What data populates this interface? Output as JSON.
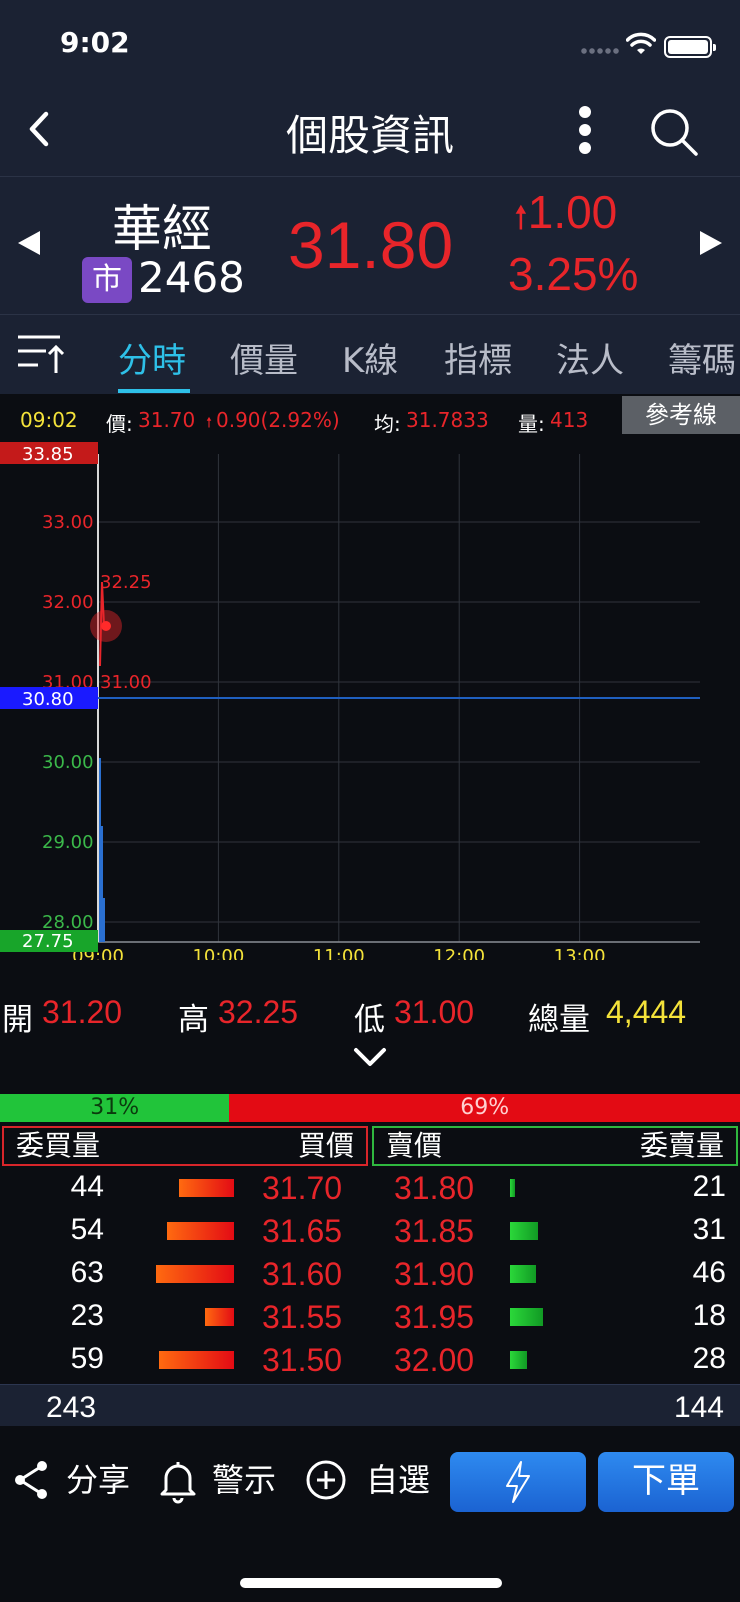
{
  "status_bar": {
    "time": "9:02"
  },
  "nav": {
    "title": "個股資訊"
  },
  "stock": {
    "name": "華經",
    "market_badge": "市",
    "code": "2468",
    "price": "31.80",
    "change": "1.00",
    "change_pct": "3.25%"
  },
  "tabs": [
    "分時",
    "價量",
    "K線",
    "指標",
    "法人",
    "籌碼"
  ],
  "info": {
    "time": "09:02",
    "price_label": "價:",
    "price": "31.70",
    "change": "0.90(2.92%)",
    "avg_label": "均:",
    "avg": "31.7833",
    "vol_label": "量:",
    "vol": "413",
    "ref_button": "參考線"
  },
  "chart_data": {
    "type": "line",
    "title": "",
    "ylim": [
      27.75,
      33.85
    ],
    "y_ticks": [
      "33.00",
      "32.00",
      "31.00",
      "30.00",
      "29.00",
      "28.00"
    ],
    "y_top_label": "33.85",
    "y_bottom_label": "27.75",
    "reference_price": "30.80",
    "x_ticks": [
      "09:00",
      "10:00",
      "11:00",
      "12:00",
      "13:00"
    ],
    "annotations": {
      "high": "32.25",
      "low": "31.00"
    },
    "series": [
      {
        "x": [
          "09:00",
          "09:01",
          "09:02"
        ],
        "values": [
          31.2,
          32.25,
          31.7
        ]
      }
    ],
    "volume_bars": [
      0.92,
      0.58,
      0.22
    ],
    "colors": {
      "up": "#e8252a",
      "down": "#3bb84a",
      "ref": "#1f5fbf",
      "line": "#e8252a"
    }
  },
  "summary": {
    "open_label": "開",
    "open": "31.20",
    "high_label": "高",
    "high": "32.25",
    "low_label": "低",
    "low": "31.00",
    "total_label": "總量",
    "total": "4,444"
  },
  "ratio": {
    "buy": "31%",
    "sell": "69%",
    "buy_fraction": 0.31
  },
  "order_book": {
    "headers": {
      "bid_qty": "委買量",
      "bid_price": "買價",
      "ask_price": "賣價",
      "ask_qty": "委賣量"
    },
    "rows": [
      {
        "bid_qty": "44",
        "bid": "31.70",
        "ask": "31.80",
        "ask_qty": "21",
        "bid_bar": 0.7,
        "ask_bar": 0.1
      },
      {
        "bid_qty": "54",
        "bid": "31.65",
        "ask": "31.85",
        "ask_qty": "31",
        "bid_bar": 0.86,
        "ask_bar": 0.53
      },
      {
        "bid_qty": "63",
        "bid": "31.60",
        "ask": "31.90",
        "ask_qty": "46",
        "bid_bar": 1.0,
        "ask_bar": 0.5
      },
      {
        "bid_qty": "23",
        "bid": "31.55",
        "ask": "31.95",
        "ask_qty": "18",
        "bid_bar": 0.37,
        "ask_bar": 0.63
      },
      {
        "bid_qty": "59",
        "bid": "31.50",
        "ask": "32.00",
        "ask_qty": "28",
        "bid_bar": 0.96,
        "ask_bar": 0.32
      }
    ],
    "totals": {
      "bid": "243",
      "ask": "144"
    }
  },
  "bottom": {
    "share": "分享",
    "alert": "警示",
    "watch": "自選",
    "order": "下單"
  }
}
